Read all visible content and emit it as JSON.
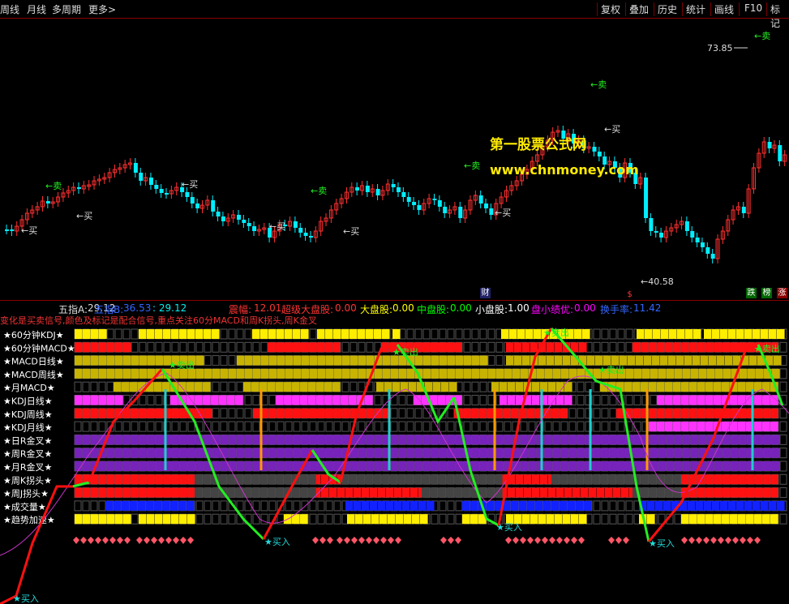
{
  "topbar": {
    "left_items": [
      "周线",
      "月线",
      "多周期",
      "更多>"
    ],
    "right_items": [
      "复权",
      "叠加",
      "历史",
      "统计",
      "画线",
      "F10",
      "标记"
    ]
  },
  "chart": {
    "high_label": "73.85",
    "low_label": "40.58",
    "signals": [
      {
        "text": "←买",
        "kind": "buy"
      },
      {
        "text": "←卖",
        "kind": "sell"
      },
      {
        "text": "←买",
        "kind": "buy"
      },
      {
        "text": "←买",
        "kind": "buy"
      },
      {
        "text": "←卖",
        "kind": "sell"
      },
      {
        "text": "←买",
        "kind": "buy"
      },
      {
        "text": "←买",
        "kind": "buy"
      },
      {
        "text": "←卖",
        "kind": "sell"
      },
      {
        "text": "←买",
        "kind": "buy"
      },
      {
        "text": "←卖",
        "kind": "sell"
      },
      {
        "text": "←买",
        "kind": "buy"
      },
      {
        "text": "←卖",
        "kind": "sell"
      }
    ],
    "watermark_line1": "第一股票公式网",
    "watermark_line2": "www.chnmoney.com",
    "bottom_tags": {
      "cai": "财",
      "dollar": "$",
      "die": "跌",
      "bang": "榜",
      "zhang": "涨"
    }
  },
  "stats": {
    "wuzhi_a_label": "五指A:",
    "wuzhi_a_value": "29.12",
    "wuzhi_b_label": "五指B:",
    "wuzhi_b_value": "36.53",
    "wuzhi_c_value": ": 29.12",
    "zhenfu_label": "震幅:",
    "zhenfu_value": "12.01",
    "chaoji_label": "超级大盘股:",
    "chaoji_value": "0.00",
    "dapan_label": "大盘股:",
    "dapan_value": "0.00",
    "zhongpan_label": "中盘股:",
    "zhongpan_value": "0.00",
    "xiaopan_label": "小盘股:",
    "xiaopan_value": "1.00",
    "panxiao_label": "盘小绩优:",
    "panxiao_value": "0.00",
    "huanshou_label": "换手率:",
    "huanshou_value": "11.42"
  },
  "description": "变化是买卖信号,颜色及标记是配合信号,重点关注60分MACD和周K拐头,周K金叉",
  "indicator": {
    "row_labels": [
      "★60分钟KDJ★",
      "★60分钟MACD★",
      "★MACD日线★",
      "★MACD周线★",
      "★月MACD★",
      "★KDJ日线★",
      "★KDJ周线★",
      "★KDJ月线★",
      "★日R金叉★",
      "★周R金叉★",
      "★月R金叉★",
      "★周K拐头★",
      "★周J拐头★",
      "★成交量★",
      "★趋势加速★"
    ],
    "signal_labels": {
      "sell1": "卖出",
      "sell2": "卖出",
      "sell3": "卖出",
      "sell4": "卖出",
      "sell5": "卖出",
      "buy1": "买入",
      "buy2": "买入",
      "buy3": "买入",
      "buy4": "买入"
    },
    "colors": {
      "yellow": "#ffee00",
      "red": "#ff1111",
      "olive": "#c8b400",
      "magenta": "#ff33ff",
      "purple": "#7722bb",
      "gray": "#444444",
      "blue": "#1122ff",
      "rise": "#ff3030",
      "fall": "#00eeff",
      "line_red": "#ff1010",
      "line_green": "#22ee22"
    }
  }
}
